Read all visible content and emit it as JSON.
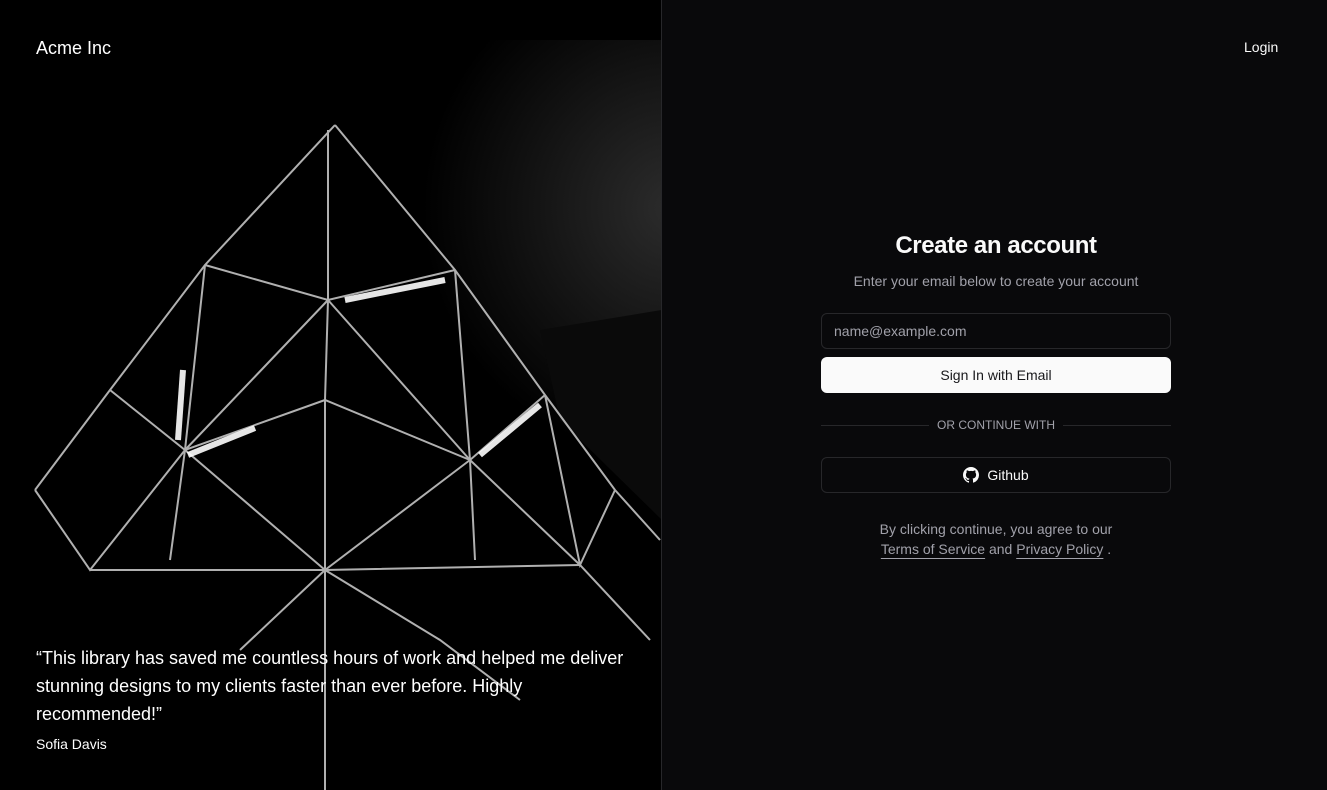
{
  "brand": {
    "name": "Acme Inc"
  },
  "header": {
    "login_label": "Login"
  },
  "testimonial": {
    "quote": "“This library has saved me countless hours of work and helped me deliver stunning designs to my clients faster than ever before. Highly recommended!”",
    "author": "Sofia Davis"
  },
  "form": {
    "title": "Create an account",
    "subtitle": "Enter your email below to create your account",
    "email_placeholder": "name@example.com",
    "email_value": "",
    "submit_label": "Sign In with Email",
    "divider_label": "OR CONTINUE WITH",
    "github_label": "Github",
    "github_icon": "github-icon",
    "legal_prefix": "By clicking continue, you agree to our",
    "terms_label": "Terms of Service",
    "and_label": "and",
    "privacy_label": "Privacy Policy",
    "period": "."
  }
}
